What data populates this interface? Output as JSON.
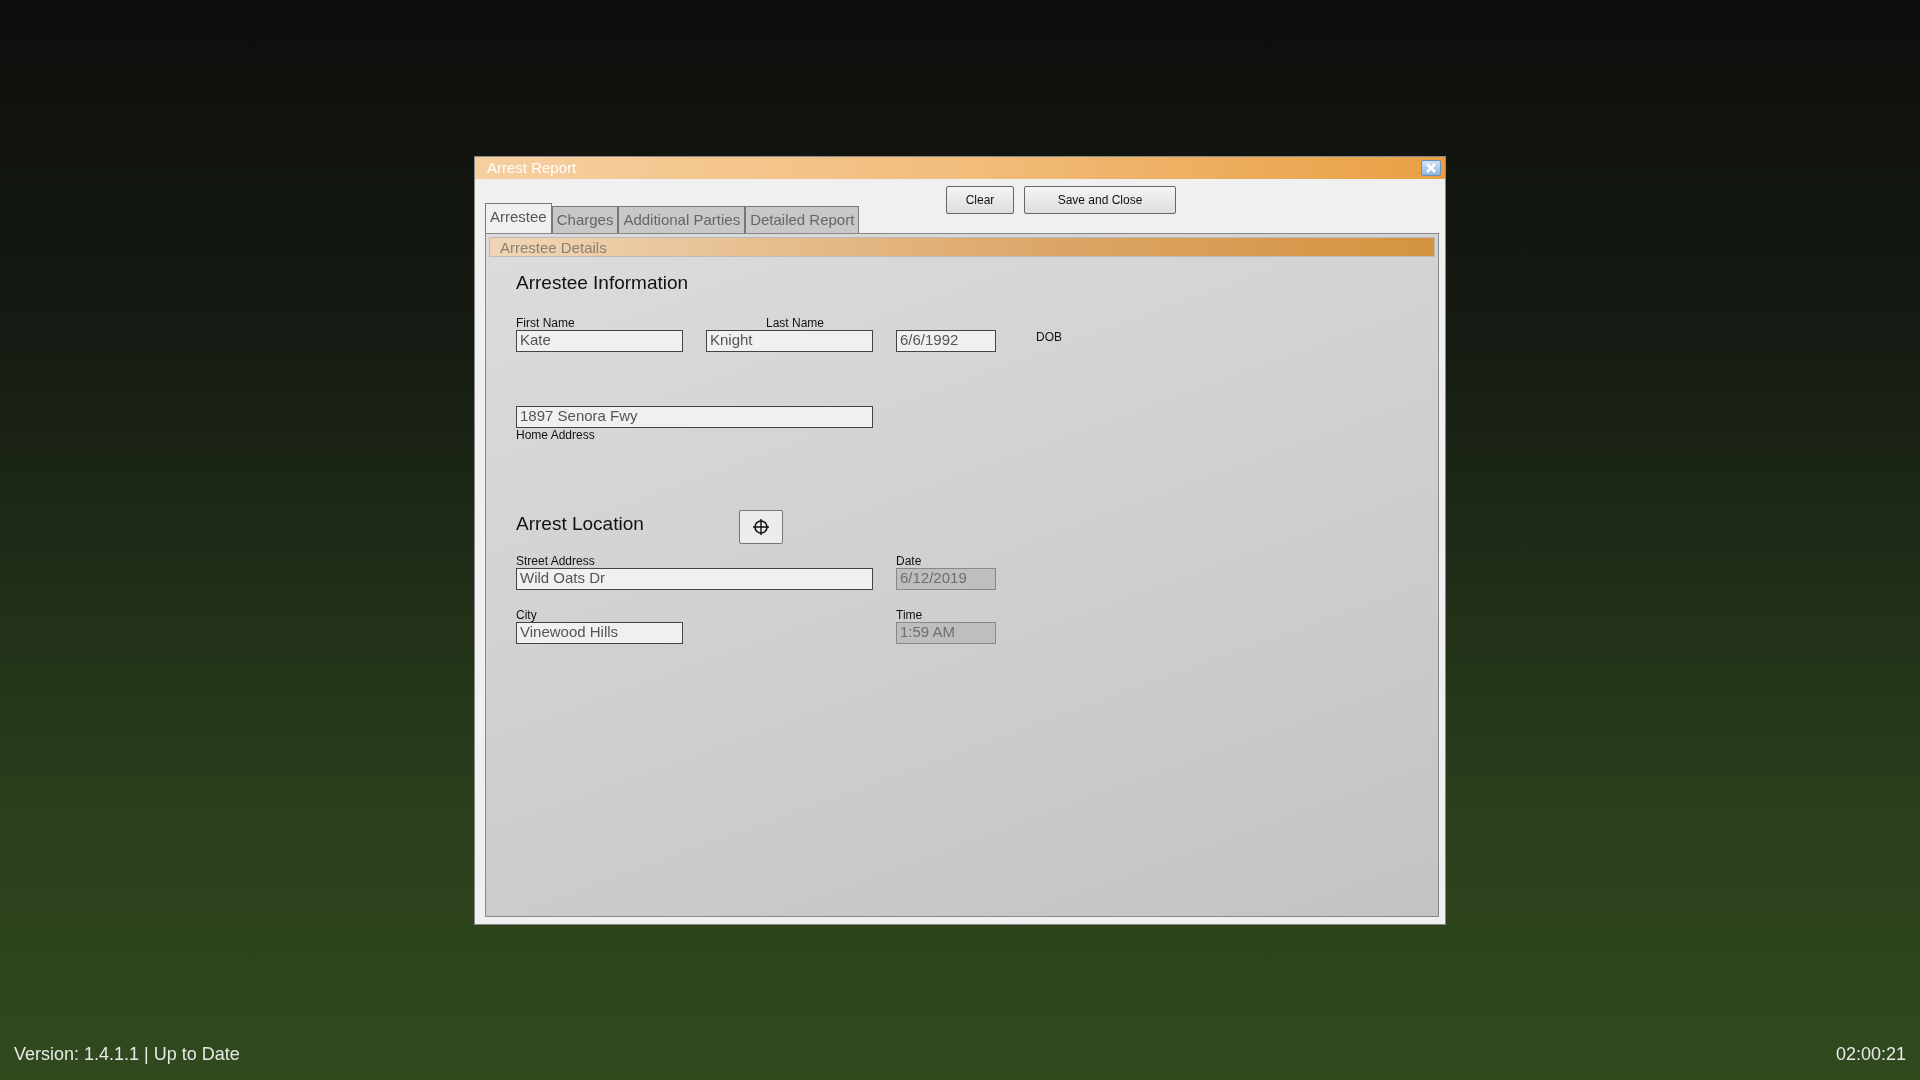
{
  "window": {
    "title": "Arrest Report"
  },
  "buttons": [
    {
      "label": "Clear"
    },
    {
      "label": "Save and Close"
    }
  ],
  "tabs": [
    {
      "label": "Arrestee",
      "selected": true
    },
    {
      "label": "Charges",
      "selected": false
    },
    {
      "label": "Additional Parties",
      "selected": false
    },
    {
      "label": "Detailed Report",
      "selected": false
    }
  ],
  "panel": {
    "title": "Arrestee Details"
  },
  "arrestee_section": {
    "heading": "Arrestee Information",
    "fields": [
      {
        "label": "First Name",
        "value": "Kate",
        "disabled": false
      },
      {
        "label": "Last Name",
        "value": "Knight",
        "disabled": false
      },
      {
        "label": "DOB",
        "value": "6/6/1992",
        "disabled": false
      },
      {
        "label": "Home Address",
        "value": "1897 Senora Fwy",
        "disabled": false
      }
    ]
  },
  "location_section": {
    "heading": "Arrest Location",
    "fields": [
      {
        "label": "Street Address",
        "value": "Wild Oats Dr",
        "disabled": false
      },
      {
        "label": "City",
        "value": "Vinewood Hills",
        "disabled": false
      },
      {
        "label": "Date",
        "value": "6/12/2019",
        "disabled": true
      },
      {
        "label": "Time",
        "value": "1:59 AM",
        "disabled": true
      }
    ]
  },
  "footer": {
    "version": "Version: 1.4.1.1 | Up to Date",
    "clock": "02:00:21"
  }
}
